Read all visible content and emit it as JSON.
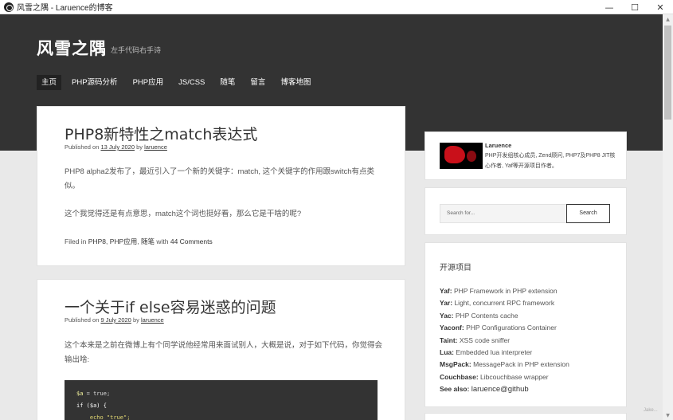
{
  "window": {
    "title": "风雪之隅 - Laruence的博客",
    "minimize": "—",
    "maximize": "☐",
    "close": "✕"
  },
  "header": {
    "site_title": "风雪之隅",
    "tagline": "左手代码右手诗",
    "nav": [
      {
        "label": "主页",
        "active": true
      },
      {
        "label": "PHP源码分析"
      },
      {
        "label": "PHP应用"
      },
      {
        "label": "JS/CSS"
      },
      {
        "label": "随笔"
      },
      {
        "label": "留言"
      },
      {
        "label": "博客地图"
      }
    ]
  },
  "posts": [
    {
      "title": "PHP8新特性之match表达式",
      "published_prefix": "Published on",
      "date": "13 July 2020",
      "by": "by",
      "author": "laruence",
      "para1": "PHP8 alpha2发布了，最近引入了一个新的关键字：match, 这个关键字的作用跟switch有点类似。",
      "para2": "这个我觉得还是有点意思，match这个词也挺好看，那么它是干啥的呢?",
      "filed_prefix": "Filed in",
      "cat1": "PHP8",
      "cat2": "PHP应用",
      "cat3": "随笔",
      "with": "with",
      "comments": "44 Comments"
    },
    {
      "title": "一个关于if else容易迷惑的问题",
      "published_prefix": "Published on",
      "date": "9 July 2020",
      "by": "by",
      "author": "laruence",
      "para1": "这个本来是之前在微博上有个同学说他经常用来面试别人，大概是说，对于如下代码，你觉得会输出啥:",
      "code_line1_var": "$a",
      "code_line1_rest": " = true;",
      "code_line2": "if ($a) {",
      "code_line3": "    echo \"true\";"
    }
  ],
  "sidebar": {
    "author_name": "Laruence",
    "author_bio": "PHP开发组核心成员, Zend顾问, PHP7及PHP8 JIT核心作者, Yaf等开源项目作者。",
    "search_placeholder": "Search for...",
    "search_button": "Search",
    "projects_title": "开源项目",
    "projects": [
      {
        "name": "Yaf:",
        "desc": "PHP Framework in PHP extension"
      },
      {
        "name": "Yar:",
        "desc": "Light, concurrent RPC framework"
      },
      {
        "name": "Yac:",
        "desc": "PHP Contents cache"
      },
      {
        "name": "Yaconf:",
        "desc": "PHP Configurations Container"
      },
      {
        "name": "Taint:",
        "desc": "XSS code sniffer"
      },
      {
        "name": "Lua:",
        "desc": "Embedded lua interpreter"
      },
      {
        "name": "MsgPack:",
        "desc": "MessagePack in PHP extension"
      },
      {
        "name": "Couchbase:",
        "desc": "Libcouchbase wrapper"
      },
      {
        "name": "See also:",
        "desc": "laruence@github"
      }
    ]
  },
  "watermark": "Jake..."
}
